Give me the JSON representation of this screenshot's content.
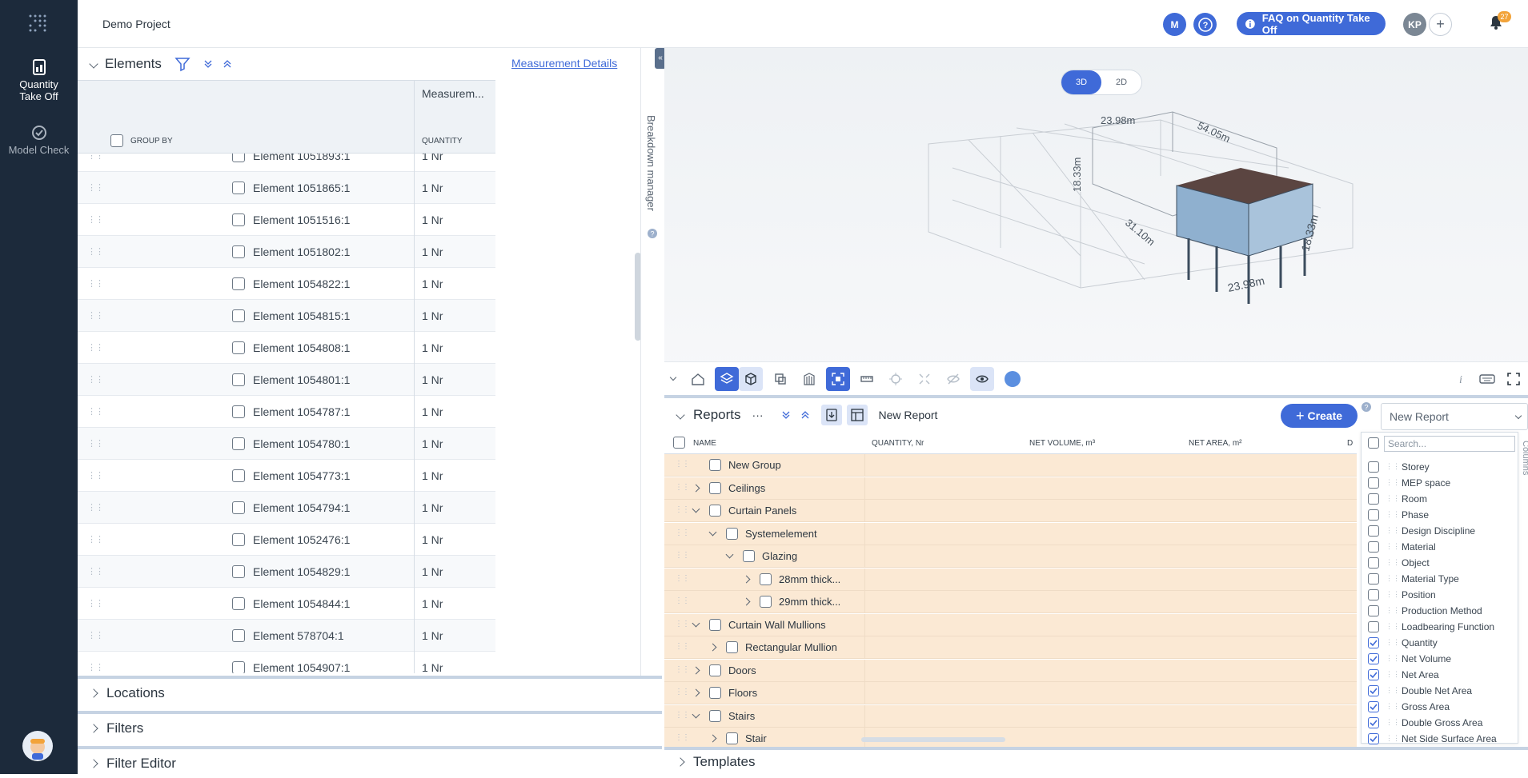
{
  "nav": {
    "items": [
      {
        "label": "Quantity Take Off",
        "icon": "quantity-takeoff-icon",
        "active": true
      },
      {
        "label": "Model Check",
        "icon": "model-check-icon",
        "active": false
      }
    ]
  },
  "topbar": {
    "project": "Demo Project",
    "avatar_m": "M",
    "help_icon": "help-icon",
    "faq_label": "FAQ on Quantity Take Off",
    "avatar_kp": "KP",
    "notifications_count": "27"
  },
  "elements": {
    "title": "Elements",
    "measurement_details": "Measurement Details",
    "column_header": "Measurem...",
    "group_by": "GROUP BY",
    "quantity_header": "QUANTITY",
    "breakdown_manager": "Breakdown manager",
    "rows": [
      {
        "name": "Element 1051893:1",
        "qty": "1 Nr"
      },
      {
        "name": "Element 1051865:1",
        "qty": "1 Nr"
      },
      {
        "name": "Element 1051516:1",
        "qty": "1 Nr"
      },
      {
        "name": "Element 1051802:1",
        "qty": "1 Nr"
      },
      {
        "name": "Element 1054822:1",
        "qty": "1 Nr"
      },
      {
        "name": "Element 1054815:1",
        "qty": "1 Nr"
      },
      {
        "name": "Element 1054808:1",
        "qty": "1 Nr"
      },
      {
        "name": "Element 1054801:1",
        "qty": "1 Nr"
      },
      {
        "name": "Element 1054787:1",
        "qty": "1 Nr"
      },
      {
        "name": "Element 1054780:1",
        "qty": "1 Nr"
      },
      {
        "name": "Element 1054773:1",
        "qty": "1 Nr"
      },
      {
        "name": "Element 1054794:1",
        "qty": "1 Nr"
      },
      {
        "name": "Element 1052476:1",
        "qty": "1 Nr"
      },
      {
        "name": "Element 1054829:1",
        "qty": "1 Nr"
      },
      {
        "name": "Element 1054844:1",
        "qty": "1 Nr"
      },
      {
        "name": "Element 578704:1",
        "qty": "1 Nr"
      },
      {
        "name": "Element 1054907:1",
        "qty": "1 Nr"
      }
    ]
  },
  "sections": {
    "locations": "Locations",
    "filters": "Filters",
    "filter_editor": "Filter Editor"
  },
  "viewer": {
    "mode_3d": "3D",
    "mode_2d": "2D",
    "dims": [
      "23.98m",
      "54.05m",
      "18.33m",
      "31.10m",
      "18.33m",
      "23.98m"
    ]
  },
  "reports": {
    "title": "Reports",
    "more": "···",
    "report_name": "New Report",
    "create_label": "Create",
    "select_value": "New Report",
    "columns": [
      "NAME",
      "QUANTITY, Nr",
      "NET VOLUME, m³",
      "NET AREA, m²",
      "D"
    ],
    "rows": [
      {
        "name": "New Group",
        "expander": "none"
      },
      {
        "name": "Ceilings",
        "expander": "collapsed"
      },
      {
        "name": "Curtain Panels",
        "expander": "expanded"
      },
      {
        "name": "Systemelement",
        "expander": "expanded"
      },
      {
        "name": "Glazing",
        "expander": "expanded"
      },
      {
        "name": "28mm thick...",
        "expander": "collapsed"
      },
      {
        "name": "29mm thick...",
        "expander": "collapsed"
      },
      {
        "name": "Curtain Wall Mullions",
        "expander": "expanded"
      },
      {
        "name": "Rectangular Mullion",
        "expander": "collapsed"
      },
      {
        "name": "Doors",
        "expander": "collapsed"
      },
      {
        "name": "Floors",
        "expander": "collapsed"
      },
      {
        "name": "Stairs",
        "expander": "expanded"
      },
      {
        "name": "Stair",
        "expander": "collapsed"
      }
    ],
    "columns_panel_label": "Columns",
    "search_placeholder": "Search...",
    "column_options": [
      {
        "label": "Storey",
        "checked": false
      },
      {
        "label": "MEP space",
        "checked": false
      },
      {
        "label": "Room",
        "checked": false
      },
      {
        "label": "Phase",
        "checked": false
      },
      {
        "label": "Design Discipline",
        "checked": false
      },
      {
        "label": "Material",
        "checked": false
      },
      {
        "label": "Object",
        "checked": false
      },
      {
        "label": "Material Type",
        "checked": false
      },
      {
        "label": "Position",
        "checked": false
      },
      {
        "label": "Production Method",
        "checked": false
      },
      {
        "label": "Loadbearing Function",
        "checked": false
      },
      {
        "label": "Quantity",
        "checked": true
      },
      {
        "label": "Net Volume",
        "checked": true
      },
      {
        "label": "Net Area",
        "checked": true
      },
      {
        "label": "Double Net Area",
        "checked": true
      },
      {
        "label": "Gross Area",
        "checked": true
      },
      {
        "label": "Double Gross Area",
        "checked": true
      },
      {
        "label": "Net Side Surface Area",
        "checked": true
      }
    ]
  },
  "templates": {
    "title": "Templates"
  },
  "colors": {
    "accent": "#3f6ad8",
    "nav_bg": "#1c2a3b",
    "report_row": "#fbe9d4",
    "badge": "#f2a33a"
  }
}
